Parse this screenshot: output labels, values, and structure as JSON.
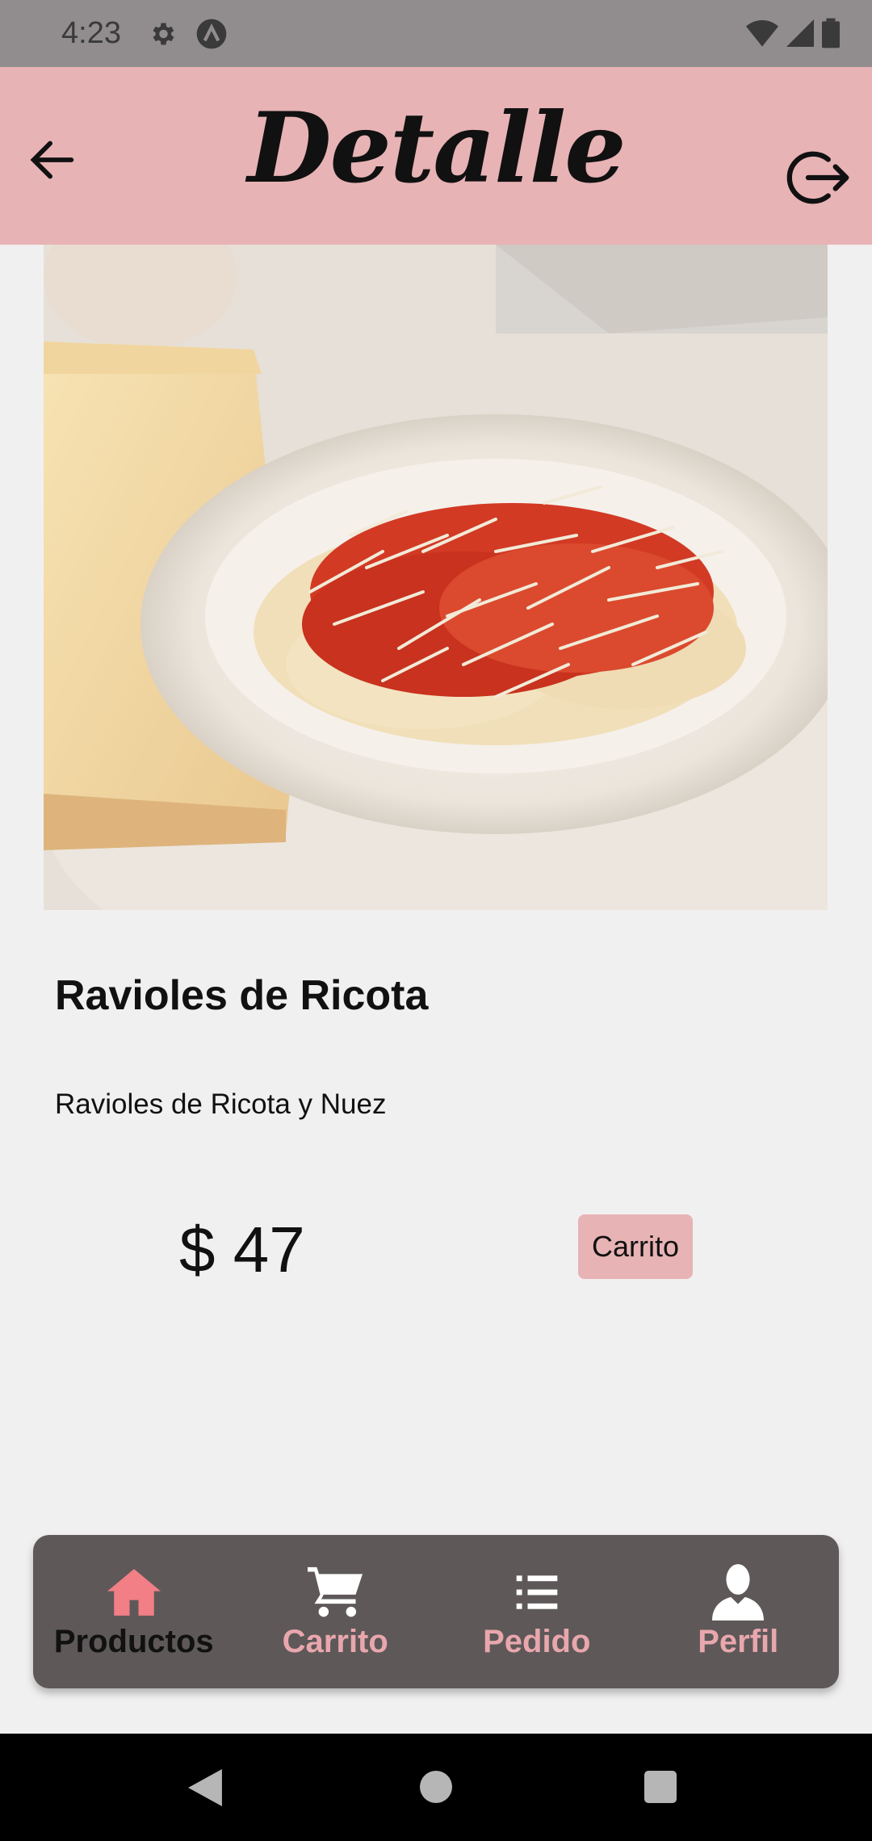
{
  "status": {
    "time": "4:23"
  },
  "header": {
    "title": "Detalle"
  },
  "product": {
    "name": "Ravioles de Ricota",
    "description": "Ravioles de Ricota y Nuez",
    "price": "$ 47",
    "cart_label": "Carrito"
  },
  "bottom_nav": {
    "items": [
      {
        "label": "Productos",
        "icon": "home-icon",
        "active": true
      },
      {
        "label": "Carrito",
        "icon": "cart-icon",
        "active": false
      },
      {
        "label": "Pedido",
        "icon": "list-icon",
        "active": false
      },
      {
        "label": "Perfil",
        "icon": "user-icon",
        "active": false
      }
    ]
  },
  "colors": {
    "appbar": "#e8b3b5",
    "statusbar": "#918d8e",
    "bottom_nav_bg": "#5e5859",
    "nav_inactive": "#e8a7ad",
    "nav_active_icon": "#f27e86"
  }
}
